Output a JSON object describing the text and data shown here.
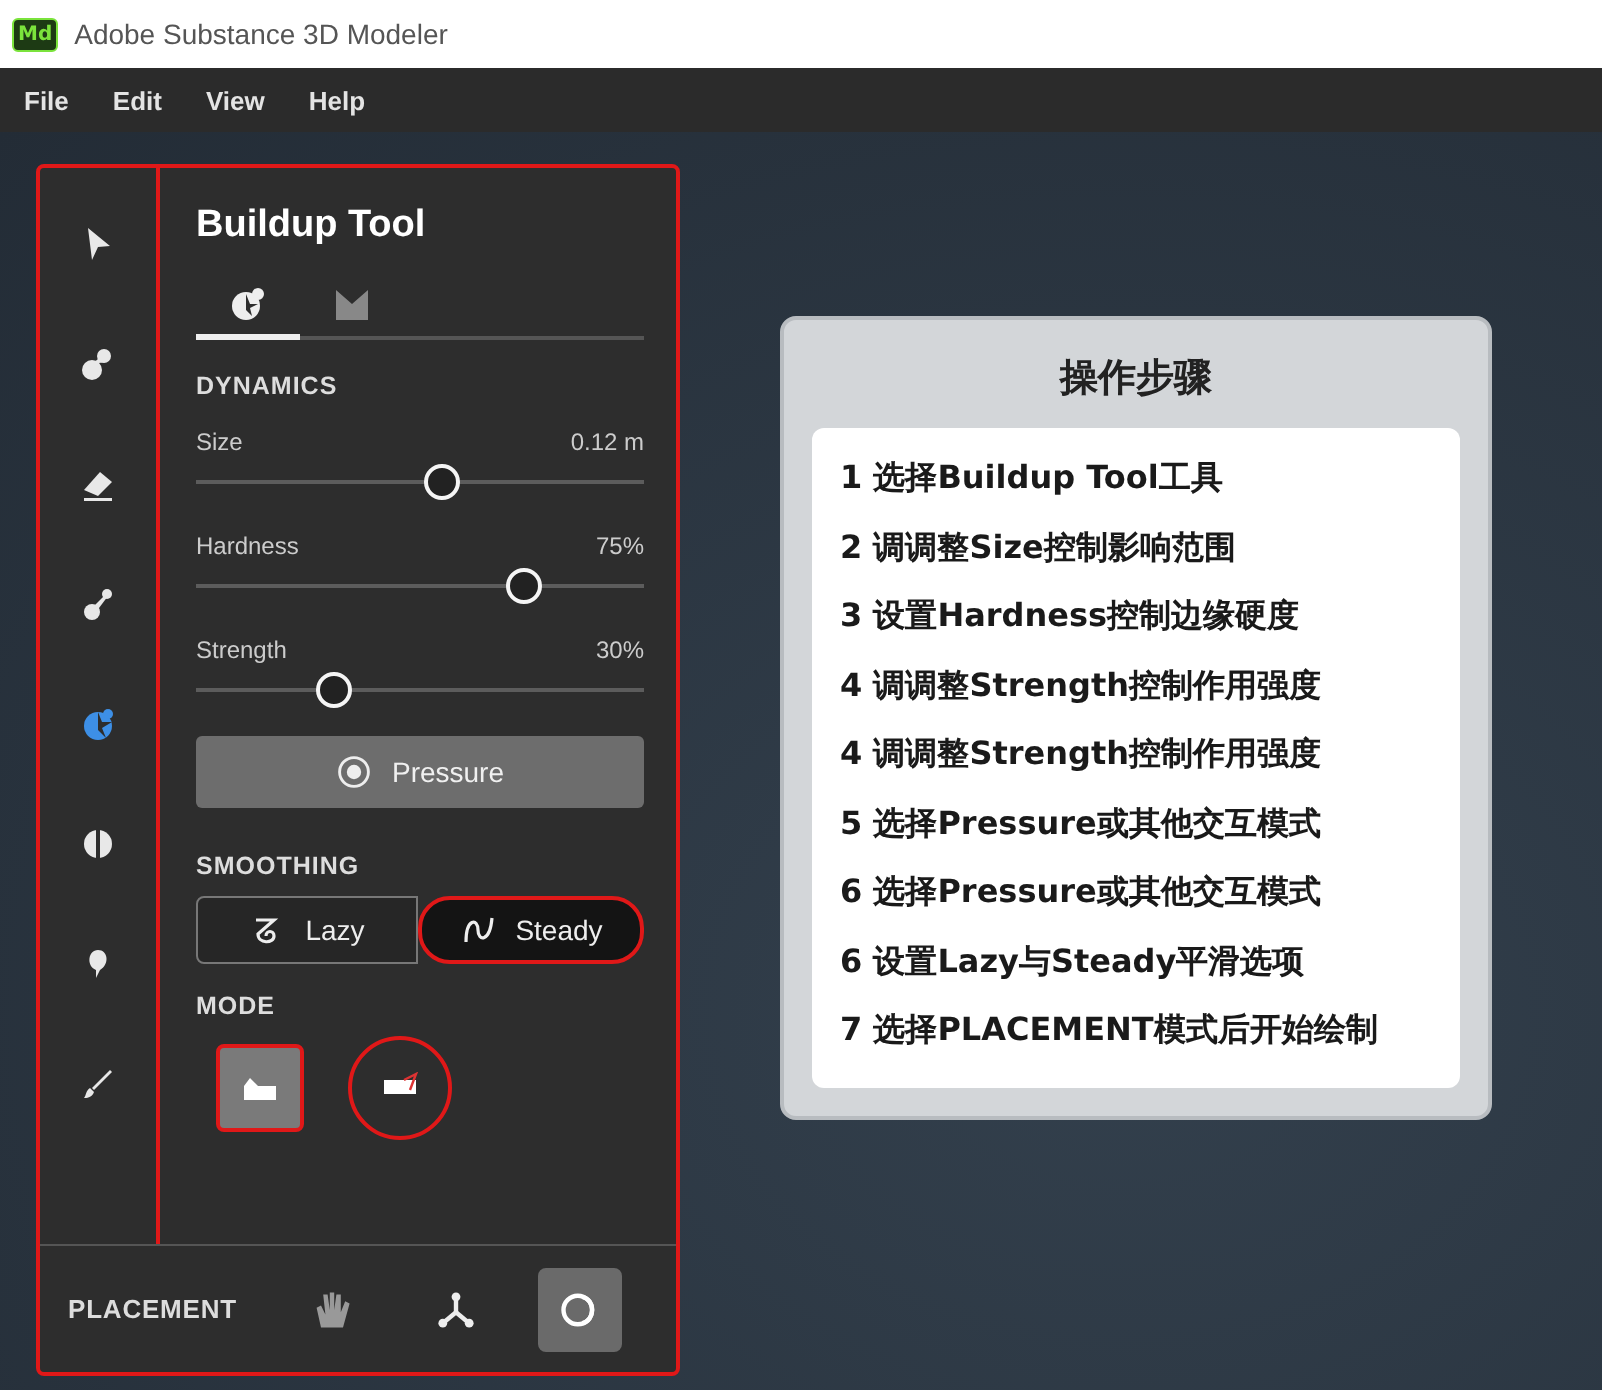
{
  "window": {
    "logo": "Md",
    "title": "Adobe Substance 3D Modeler"
  },
  "menu": [
    "File",
    "Edit",
    "View",
    "Help"
  ],
  "tools": [
    {
      "kind": "select",
      "selected": false
    },
    {
      "kind": "blob",
      "selected": false
    },
    {
      "kind": "eraser",
      "selected": false
    },
    {
      "kind": "pin",
      "selected": false
    },
    {
      "kind": "buildup",
      "selected": true
    },
    {
      "kind": "split",
      "selected": false
    },
    {
      "kind": "balloon",
      "selected": false
    },
    {
      "kind": "brush",
      "selected": false
    }
  ],
  "panel": {
    "title": "Buildup Tool",
    "tabs": [
      {
        "kind": "buildup",
        "selected": true
      },
      {
        "kind": "material",
        "selected": false
      }
    ],
    "dynamics": {
      "heading": "DYNAMICS",
      "sliders": [
        {
          "label": "Size",
          "reading": "0.12 m",
          "level": 0.55
        },
        {
          "label": "Hardness",
          "reading": "75%",
          "level": 0.73
        },
        {
          "label": "Strength",
          "reading": "30%",
          "level": 0.31
        }
      ],
      "pressure": "Pressure"
    },
    "smoothing": {
      "heading": "SMOOTHING",
      "options": [
        {
          "kind": "lazy",
          "label": "Lazy",
          "selected": false
        },
        {
          "kind": "steady",
          "label": "Steady",
          "selected": true
        }
      ]
    },
    "mode": {
      "heading": "MODE",
      "options": [
        {
          "kind": "surface",
          "selected": true
        },
        {
          "kind": "project",
          "selected": false
        }
      ]
    }
  },
  "placement": {
    "label": "PLACEMENT",
    "options": [
      {
        "kind": "hand",
        "selected": false
      },
      {
        "kind": "axes",
        "selected": false
      },
      {
        "kind": "rings",
        "selected": true
      }
    ]
  },
  "steps": {
    "title": "操作步骤",
    "items": [
      "1 选择**Buildup Tool工具**",
      "2 调调整**Size控制影响范围**",
      "3 设置**Hardness控制边缘**硬度",
      "4 调调整**Strength**控制作用强度",
      "4 调调整**Strength控制**作用强度",
      "5 选择Pressure或其他交互模式",
      "6 选择Pressure或其他交互模式",
      "6 设置**Lazy与Steady平滑选项**",
      "7 选择PLACEMENT模式后开始绘制"
    ]
  }
}
